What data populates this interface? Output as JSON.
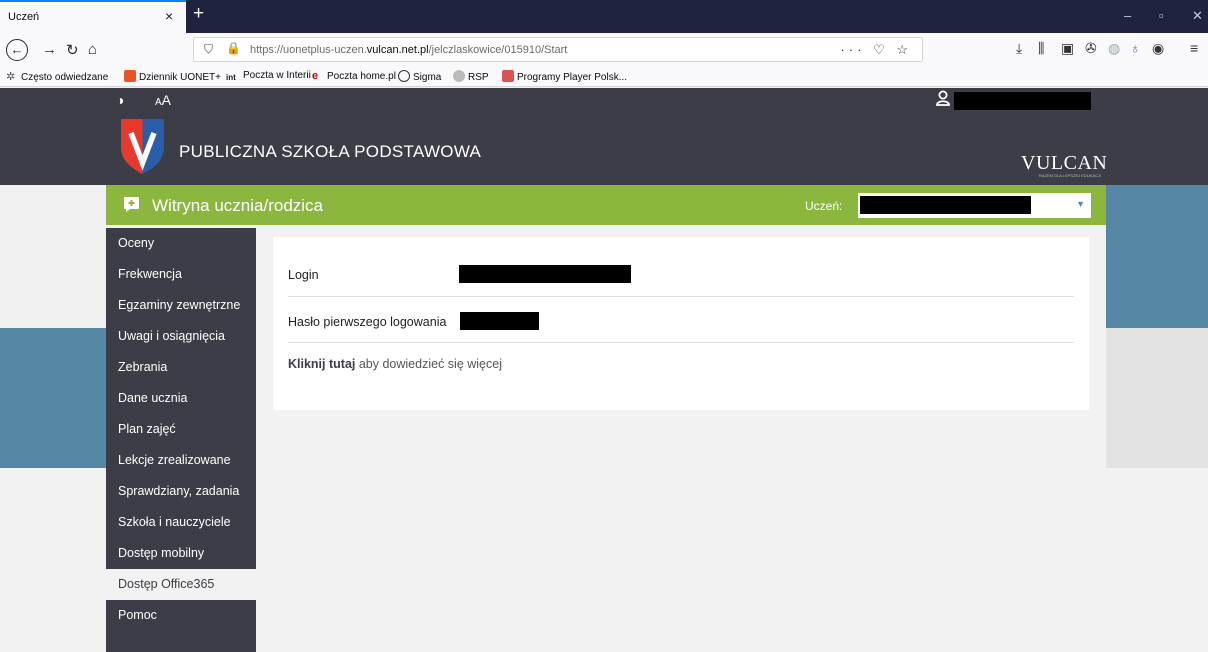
{
  "browser": {
    "tab_title": "Uczeń",
    "tab_close": "×",
    "new_tab": "+",
    "url_prefix": "https://uonetplus-uczen.",
    "url_domain": "vulcan.net.pl",
    "url_suffix": "/jelczlaskowice/015910/Start",
    "url_actions": "··· ♡ ☆",
    "window_controls": {
      "minimize": "–",
      "maximize": "▫",
      "close": "✕"
    },
    "bookmarks": [
      {
        "label": "Często odwiedzane",
        "icon": "gear-icon",
        "color": "#555555"
      },
      {
        "label": "Dziennik UONET+",
        "icon": "uonet-icon",
        "color": "#e8551e"
      },
      {
        "label": "Poczta w Interii",
        "icon": "interia-icon",
        "color": "#1a1a1a"
      },
      {
        "label": "Poczta home.pl",
        "icon": "homepl-icon",
        "color": "#cc0000"
      },
      {
        "label": "Sigma",
        "icon": "globe-icon",
        "color": "#333333"
      },
      {
        "label": "RSP",
        "icon": "rsp-icon",
        "color": "#888888"
      },
      {
        "label": "Programy Player Polsk...",
        "icon": "player-icon",
        "color": "#d9534f"
      }
    ]
  },
  "header": {
    "contrast_icon": "◑",
    "font_size_small": "A",
    "font_size_large": "A",
    "user_name": "██████████",
    "school_name": "PUBLICZNA SZKOŁA PODSTAWOWA",
    "brand": "VULCAN",
    "brand_tagline": "RAZEM DLA LEPSZEJ EDUKACJI"
  },
  "greenbar": {
    "title": "Witryna ucznia/rodzica",
    "student_label": "Uczeń:",
    "student_value": "██████████"
  },
  "menu": [
    {
      "label": "Oceny",
      "active": false
    },
    {
      "label": "Frekwencja",
      "active": false
    },
    {
      "label": "Egzaminy zewnętrzne",
      "active": false
    },
    {
      "label": "Uwagi i osiągnięcia",
      "active": false
    },
    {
      "label": "Zebrania",
      "active": false
    },
    {
      "label": "Dane ucznia",
      "active": false
    },
    {
      "label": "Plan zajęć",
      "active": false
    },
    {
      "label": "Lekcje zrealizowane",
      "active": false
    },
    {
      "label": "Sprawdziany, zadania",
      "active": false
    },
    {
      "label": "Szkoła i nauczyciele",
      "active": false
    },
    {
      "label": "Dostęp mobilny",
      "active": false
    },
    {
      "label": "Dostęp Office365",
      "active": true
    },
    {
      "label": "Pomoc",
      "active": false
    }
  ],
  "content": {
    "login_label": "Login",
    "login_value": "██████████",
    "password_label": "Hasło pierwszego logowania",
    "password_value": "██████",
    "more_link": "Kliknij tutaj",
    "more_text": " aby dowiedzieć się więcej"
  },
  "colors": {
    "header": "#3d3d47",
    "accent_green": "#8cb73f",
    "side_blue": "#5688a6",
    "logo_red": "#e63a2e",
    "logo_blue": "#2b5ea8"
  }
}
